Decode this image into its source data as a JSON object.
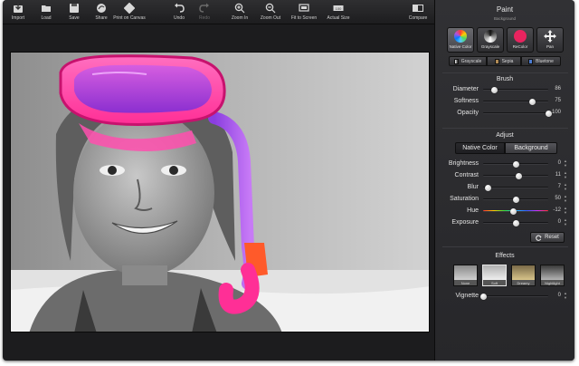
{
  "toolbar": {
    "items": [
      {
        "label": "Import",
        "icon": "import-icon"
      },
      {
        "label": "Load",
        "icon": "load-icon"
      },
      {
        "label": "Save",
        "icon": "save-icon"
      },
      {
        "label": "Share",
        "icon": "share-icon"
      },
      {
        "label": "Print on Canvas",
        "icon": "print-canvas-icon"
      },
      {
        "label": "Undo",
        "icon": "undo-icon"
      },
      {
        "label": "Redo",
        "icon": "redo-icon"
      },
      {
        "label": "Zoom In",
        "icon": "zoom-in-icon"
      },
      {
        "label": "Zoom Out",
        "icon": "zoom-out-icon"
      },
      {
        "label": "Fit to Screen",
        "icon": "fit-screen-icon"
      },
      {
        "label": "Actual Size",
        "icon": "actual-size-icon"
      },
      {
        "label": "Compare",
        "icon": "compare-icon"
      }
    ]
  },
  "panel": {
    "paint": {
      "title": "Paint",
      "sub_label": "Background",
      "tools": [
        {
          "label": "Native Color",
          "icon": "color-wheel-icon"
        },
        {
          "label": "Grayscale",
          "icon": "grayscale-icon"
        },
        {
          "label": "ReColor",
          "icon": "recolor-icon"
        },
        {
          "label": "Pan",
          "icon": "pan-icon"
        }
      ],
      "modes": [
        {
          "label": "Grayscale",
          "swatch": "#cfcfcf"
        },
        {
          "label": "Sepia",
          "swatch": "#b08a55"
        },
        {
          "label": "Bluetone",
          "swatch": "#4a7bd1"
        }
      ]
    },
    "brush": {
      "title": "Brush",
      "rows": [
        {
          "label": "Diameter",
          "value": "86",
          "level": 0.18
        },
        {
          "label": "Softness",
          "value": "75",
          "level": 0.75
        },
        {
          "label": "Opacity",
          "value": "100",
          "level": 1.0
        }
      ]
    },
    "adjust": {
      "title": "Adjust",
      "toggle": [
        "Native Color",
        "Background"
      ],
      "rows": [
        {
          "label": "Brightness",
          "value": "0",
          "level": 0.5
        },
        {
          "label": "Contrast",
          "value": "11",
          "level": 0.55
        },
        {
          "label": "Blur",
          "value": "7",
          "level": 0.07
        },
        {
          "label": "Saturation",
          "value": "50",
          "level": 0.5
        },
        {
          "label": "Hue",
          "value": "-12",
          "level": 0.47
        },
        {
          "label": "Exposure",
          "value": "0",
          "level": 0.5
        }
      ],
      "reset_label": "Reset"
    },
    "effects": {
      "title": "Effects",
      "items": [
        "None",
        "Soft",
        "Dreamy",
        "Nightlight"
      ],
      "vignette_label": "Vignette",
      "vignette_value": "0",
      "vignette_level": 0.0
    }
  },
  "colors": {
    "accent_pink": "#ff3ea0",
    "accent_purple": "#a84df0",
    "accent_orange": "#ff6a2a"
  }
}
